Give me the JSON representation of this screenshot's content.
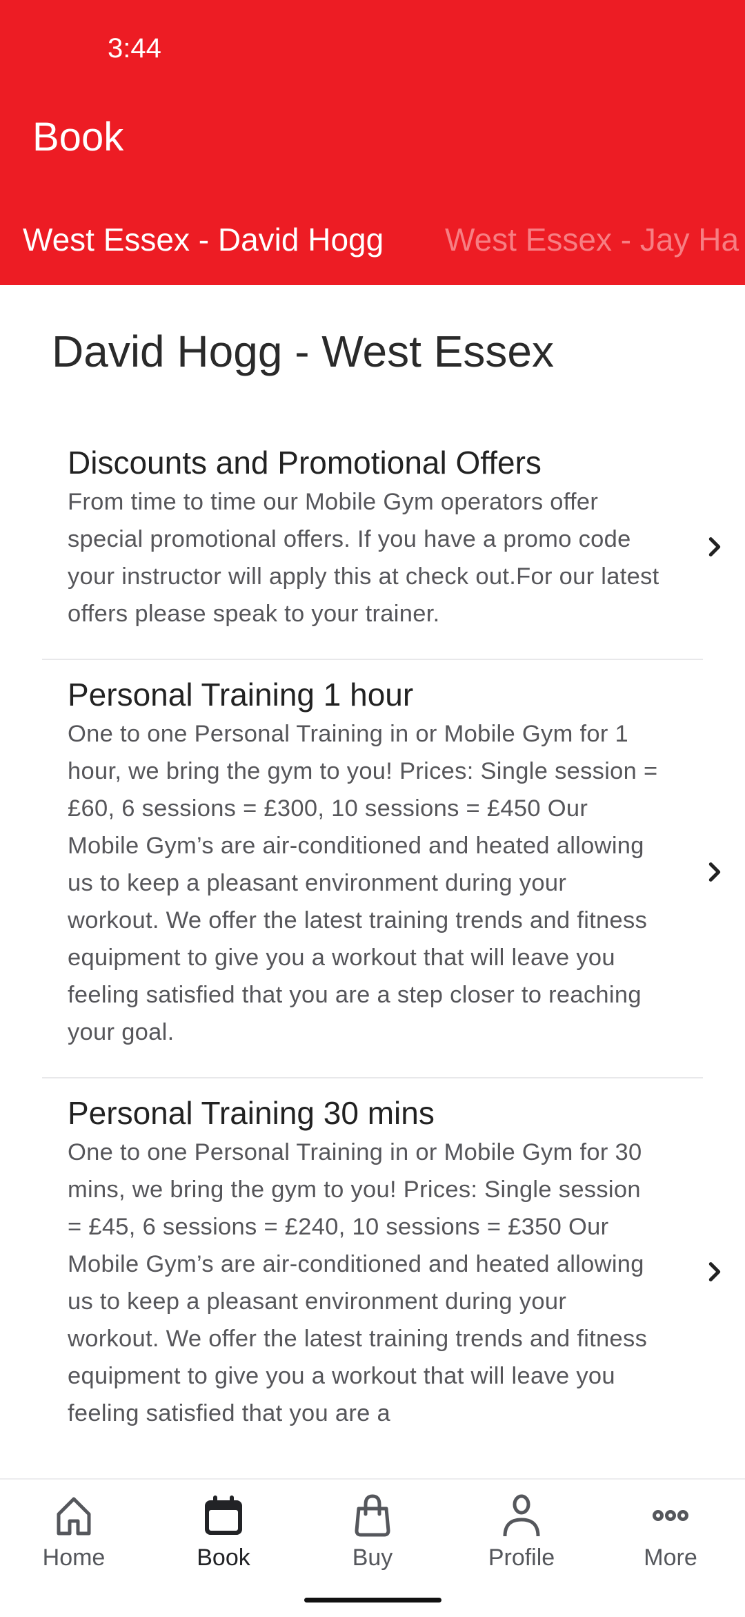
{
  "status_bar": {
    "time": "3:44"
  },
  "header": {
    "title": "Book",
    "background_color": "#ED1C24",
    "tabs": [
      {
        "label": "West Essex - David Hogg",
        "active": true
      },
      {
        "label": "West Essex - Jay Ha",
        "active": false
      }
    ]
  },
  "page": {
    "title": "David Hogg - West Essex",
    "items": [
      {
        "title": "Discounts and Promotional Offers",
        "description": "From time to time our Mobile Gym operators offer special promotional offers. If you have a promo code your instructor will apply this at check out.For our latest offers please speak to your trainer.",
        "icon": "chevron-right-icon"
      },
      {
        "title": "Personal Training 1 hour",
        "description": "One to one Personal Training in or Mobile Gym for 1 hour, we bring the gym to you! Prices: Single session = £60, 6 sessions = £300, 10 sessions = £450 Our Mobile Gym’s are air-conditioned and heated allowing us to keep a pleasant environment during your workout. We offer the latest training trends and fitness equipment to give you a workout that will leave you feeling satisfied that you are a step closer to reaching your goal.",
        "icon": "chevron-right-icon"
      },
      {
        "title": "Personal Training 30 mins",
        "description": "One to one Personal Training in or Mobile Gym for 30 mins, we bring the gym to you! Prices: Single session = £45, 6 sessions = £240, 10 sessions = £350 Our Mobile Gym’s are air-conditioned and heated allowing us to keep a pleasant environment during your workout. We offer the latest training trends and fitness equipment to give you a workout that will leave you feeling satisfied that you are a",
        "icon": "chevron-right-icon"
      }
    ]
  },
  "bottom_nav": {
    "items": [
      {
        "label": "Home",
        "icon": "home-icon",
        "active": false
      },
      {
        "label": "Book",
        "icon": "calendar-icon",
        "active": true
      },
      {
        "label": "Buy",
        "icon": "shopping-bag-icon",
        "active": false
      },
      {
        "label": "Profile",
        "icon": "person-icon",
        "active": false
      },
      {
        "label": "More",
        "icon": "more-dots-icon",
        "active": false
      }
    ]
  }
}
